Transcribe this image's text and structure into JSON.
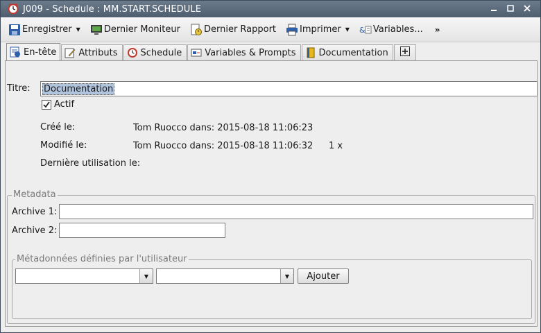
{
  "window": {
    "title": "J009 - Schedule : MM.START.SCHEDULE",
    "controls": {
      "minimize": "▫",
      "maximize": "▫",
      "close": "✕"
    }
  },
  "toolbar": {
    "save_label": "Enregistrer",
    "last_monitor_label": "Dernier Moniteur",
    "last_report_label": "Dernier Rapport",
    "print_label": "Imprimer",
    "variables_label": "Variables...",
    "more_label": "»"
  },
  "tabs": [
    {
      "label": "En-tête",
      "icon": "header-icon"
    },
    {
      "label": "Attributs",
      "icon": "attributes-icon"
    },
    {
      "label": "Schedule",
      "icon": "clock-icon"
    },
    {
      "label": "Variables & Prompts",
      "icon": "variables-icon"
    },
    {
      "label": "Documentation",
      "icon": "book-icon"
    },
    {
      "label": "[+]",
      "icon": "add-tab-icon"
    }
  ],
  "header": {
    "title_label": "Titre:",
    "title_value": "Documentation",
    "active_label": "Actif",
    "active_checked": true,
    "created_label": "Créé le:",
    "created_value": "Tom Ruocco dans: 2015-08-18 11:06:23",
    "modified_label": "Modifié le:",
    "modified_value": "Tom Ruocco dans: 2015-08-18 11:06:32",
    "modified_count": "1 x",
    "last_used_label": "Dernière utilisation le:",
    "last_used_value": ""
  },
  "metadata": {
    "legend": "Metadata",
    "archive1_label": "Archive 1:",
    "archive1_value": "",
    "archive2_label": "Archive 2:",
    "archive2_value": "",
    "user_defined_legend": "Métadonnées définies par l'utilisateur",
    "combo1_value": "",
    "combo2_value": "",
    "add_button_label": "Ajouter"
  }
}
